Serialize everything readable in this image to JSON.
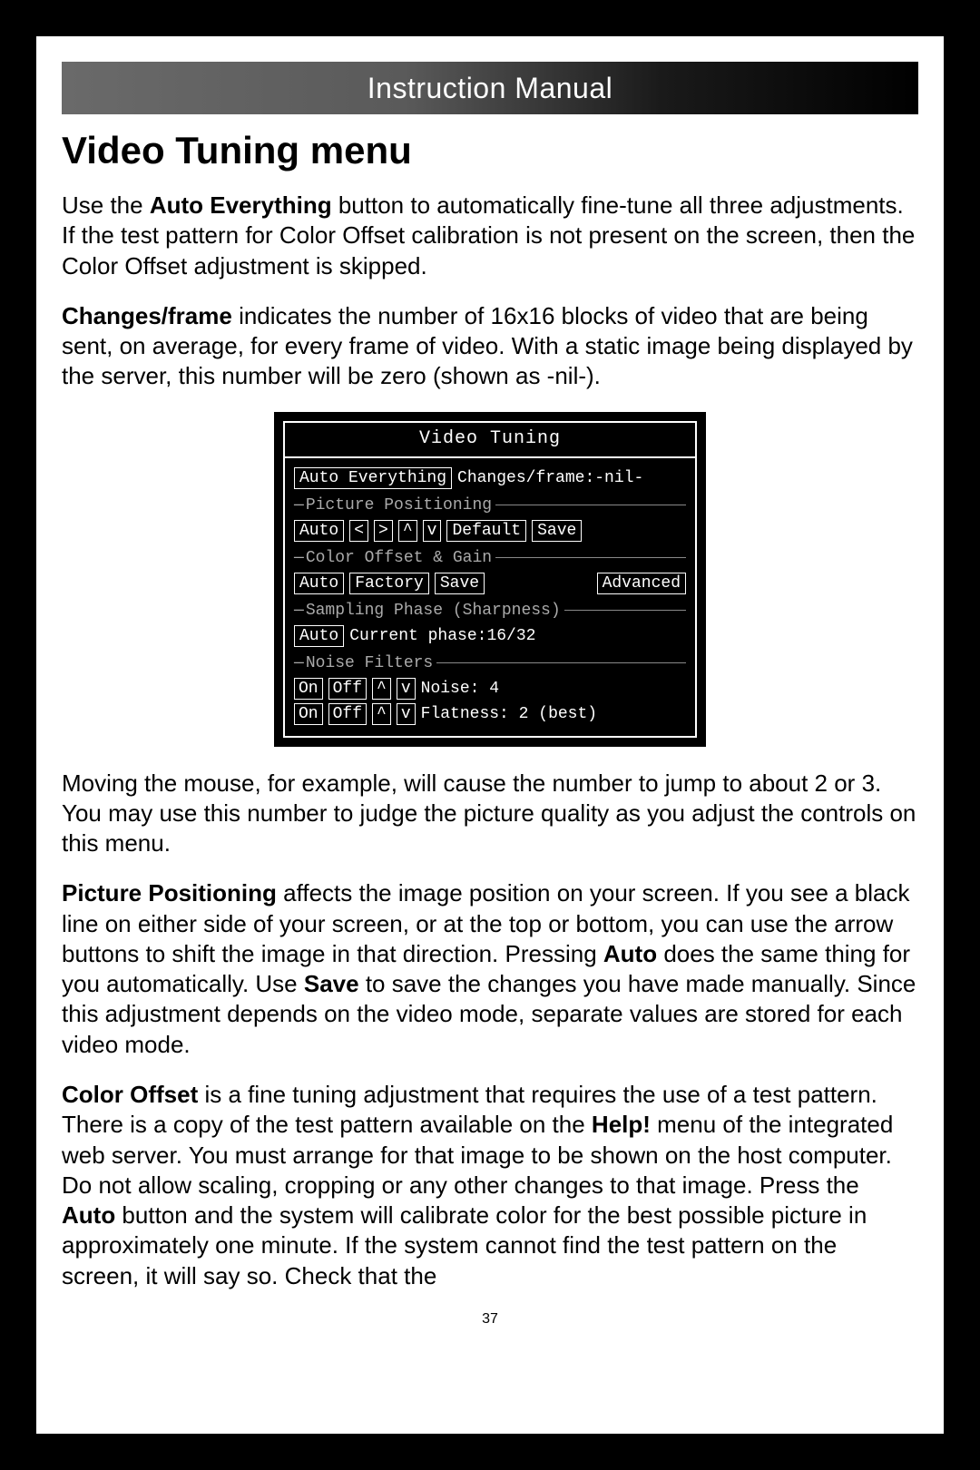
{
  "header": {
    "title": "Instruction Manual"
  },
  "section_title": "Video Tuning menu",
  "paragraphs": {
    "p1_pre": "Use the ",
    "p1_b1": "Auto Everything",
    "p1_post": " button to automatically fine-tune all three adjustments. If the test pattern for Color Offset calibration is not present on the screen, then the Color Offset adjustment is skipped.",
    "p2_b1": "Changes/frame",
    "p2_post": " indicates the number of 16x16 blocks of video that are being sent, on average, for every frame of video. With a static image being displayed by the server, this number will be zero (shown as -nil-).",
    "p3": "Moving the mouse, for example, will cause the number to jump to about 2 or 3. You may use this number to judge the picture quality as you adjust the controls on this menu.",
    "p4_b1": "Picture Positioning",
    "p4_mid1": " affects the image position on your screen. If you see a black line on either side of your screen, or at the top or bottom, you can use the arrow buttons to shift the image in that direction. Pressing ",
    "p4_b2": "Auto",
    "p4_mid2": " does the same thing for you automatically. Use ",
    "p4_b3": "Save",
    "p4_post": " to save the changes you have made manually. Since this adjustment depends on the video mode, separate values are stored for each video mode.",
    "p5_b1": "Color Offset",
    "p5_mid1": " is a fine tuning adjustment that requires the use of a test pattern. There is a copy of the test pattern available on the ",
    "p5_b2": "Help!",
    "p5_mid2": " menu of the integrated web server. You must arrange for that image to be shown on the host computer. Do not allow scaling, cropping or any other changes to that image. Press the ",
    "p5_b3": "Auto",
    "p5_post": " button and the system will calibrate color for the best possible picture in approximately one minute. If the system cannot find the test pattern on the screen, it will say so. Check that the"
  },
  "menu": {
    "title": "Video Tuning",
    "row1": {
      "btn": "Auto Everything",
      "label": "Changes/frame:-nil-"
    },
    "group1": "Picture Positioning",
    "row2": {
      "auto": "Auto",
      "left": "<",
      "right": ">",
      "up": "^",
      "down": "v",
      "default": "Default",
      "save": "Save"
    },
    "group2": "Color Offset & Gain",
    "row3": {
      "auto": "Auto",
      "factory": "Factory",
      "save": "Save",
      "advanced": "Advanced"
    },
    "group3": "Sampling Phase (Sharpness)",
    "row4": {
      "auto": "Auto",
      "label": "Current phase:16/32"
    },
    "group4": "Noise Filters",
    "row5": {
      "on": "On",
      "off": "Off",
      "up": "^",
      "down": "v",
      "label": "Noise: 4"
    },
    "row6": {
      "on": "On",
      "off": "Off",
      "up": "^",
      "down": "v",
      "label": "Flatness: 2 (best)"
    }
  },
  "page_number": "37"
}
